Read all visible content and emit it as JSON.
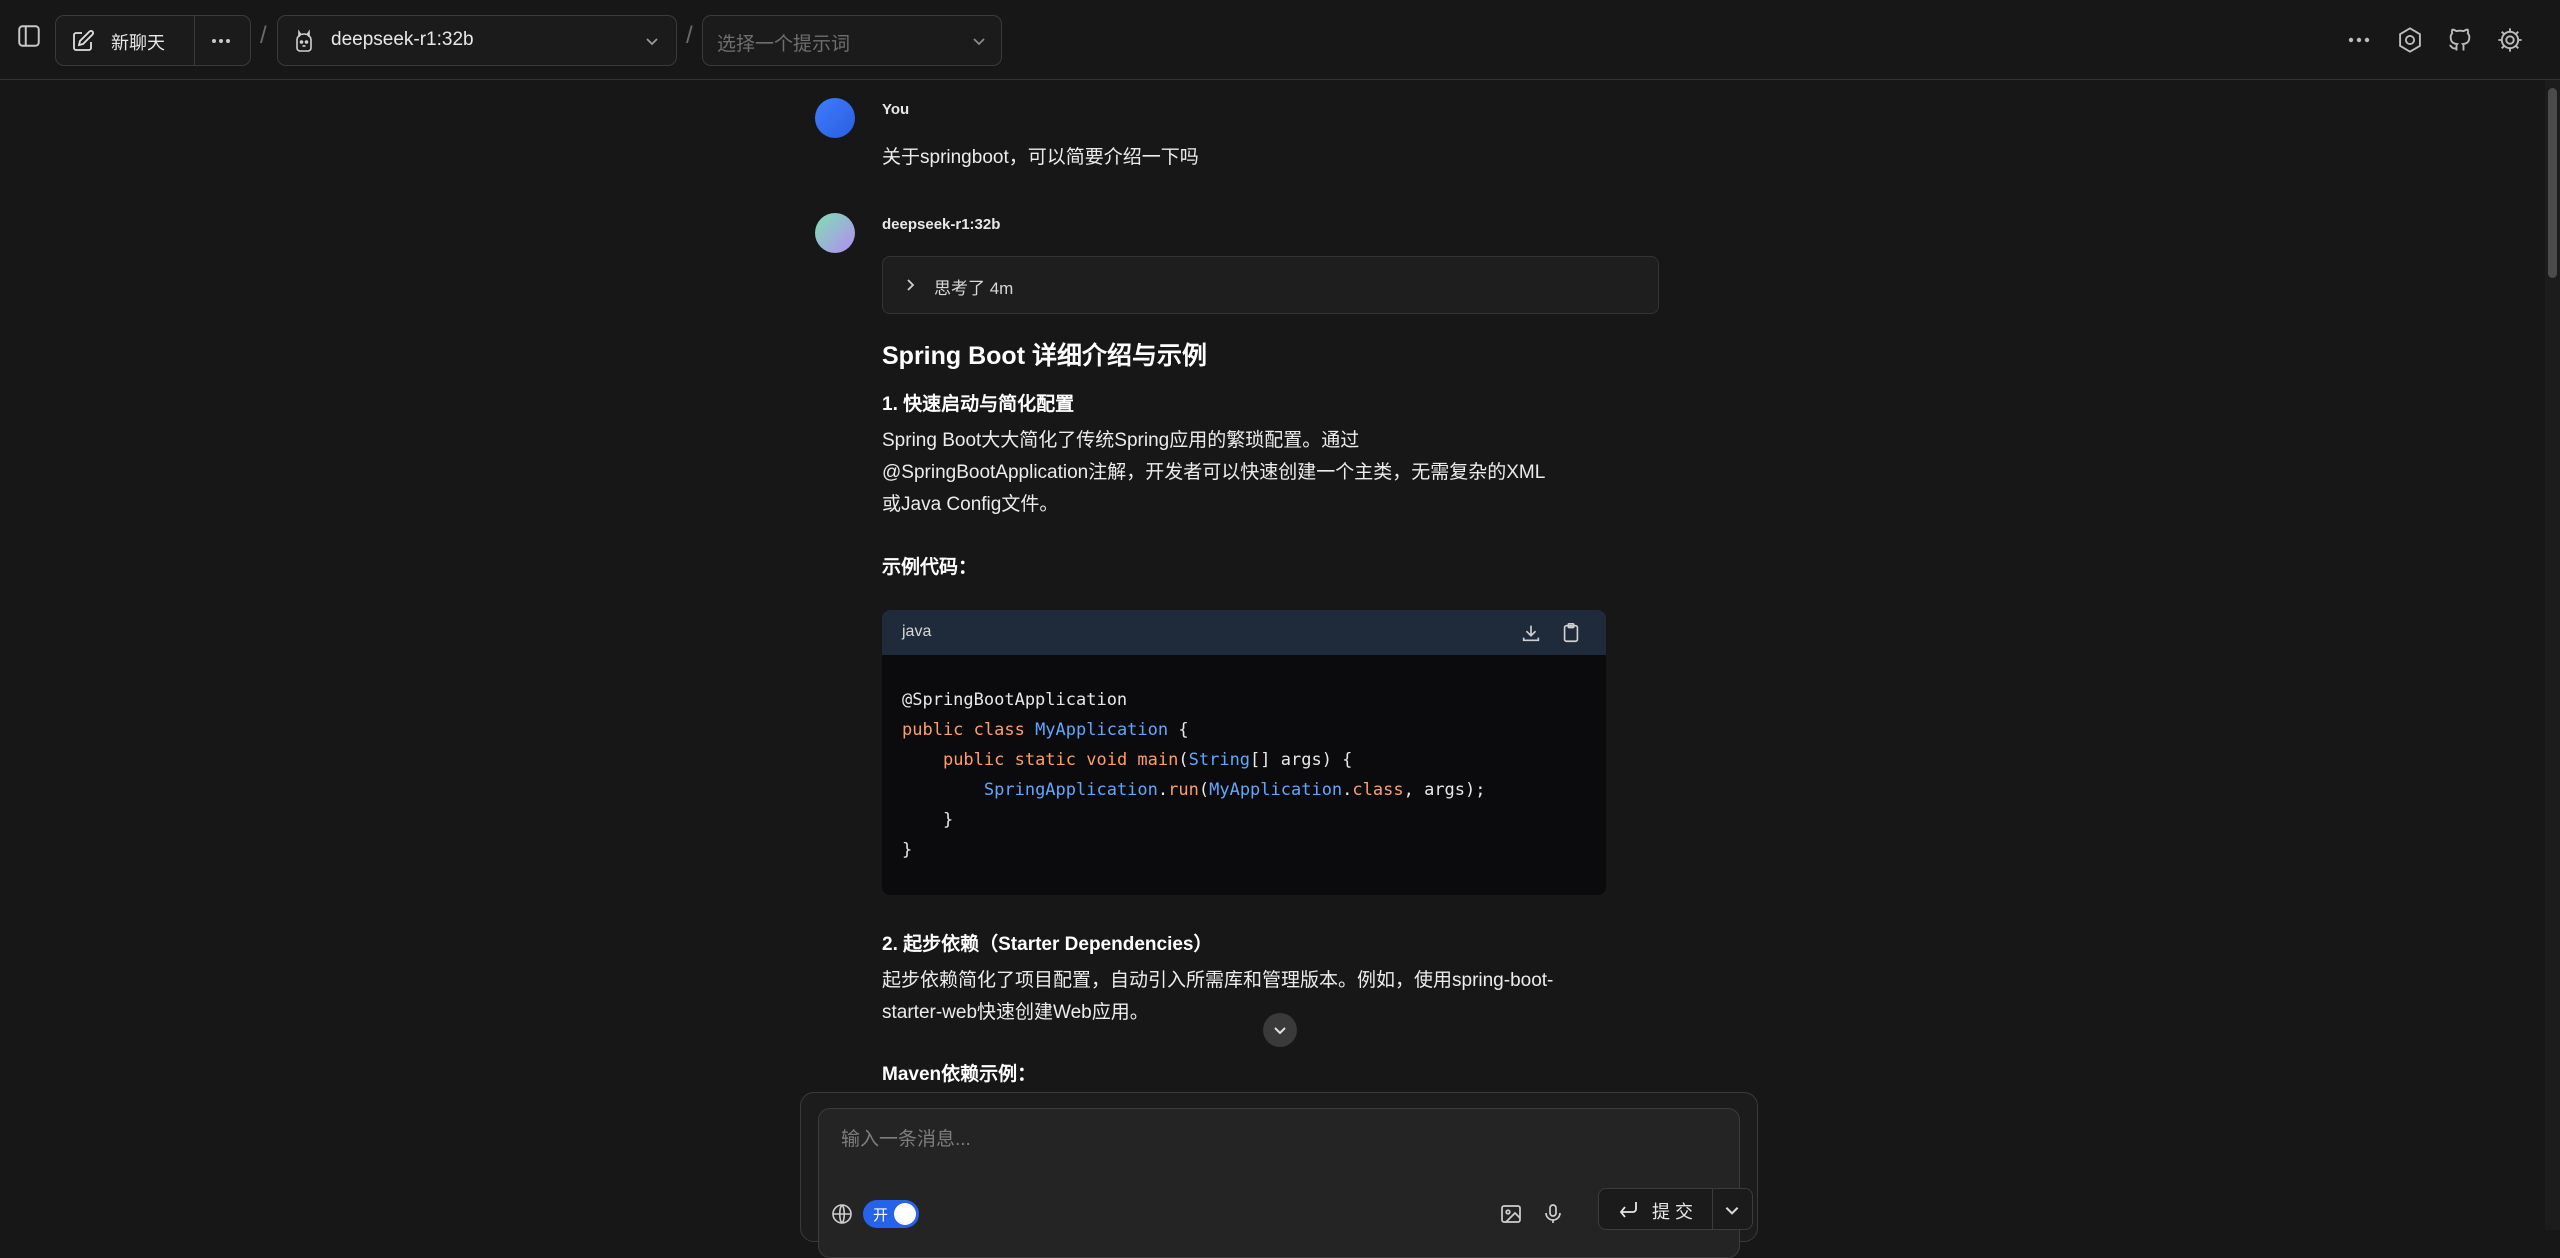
{
  "header": {
    "new_chat_label": "新聊天",
    "model_name": "deepseek-r1:32b",
    "prompt_placeholder": "选择一个提示词",
    "separator": "/"
  },
  "conversation": {
    "user": {
      "name": "You",
      "message": "关于springboot，可以简要介绍一下吗"
    },
    "assistant": {
      "name": "deepseek-r1:32b",
      "thinking_label": "思考了 4m",
      "title": "Spring Boot 详细介绍与示例",
      "section1_heading": "1. 快速启动与简化配置",
      "section1_text": [
        "Spring Boot大大简化了传统Spring应用的繁琐配置。通过",
        "@SpringBootApplication注解，开发者可以快速创建一个主类，无需复杂的XML",
        "或Java Config文件。"
      ],
      "example_label": "示例代码：",
      "code_language": "java",
      "code_lines": [
        "@SpringBootApplication",
        "public class MyApplication {",
        "    public static void main(String[] args) {",
        "        SpringApplication.run(MyApplication.class, args);",
        "    }",
        "}"
      ],
      "section2_heading": "2. 起步依赖（Starter Dependencies）",
      "section2_text": [
        "起步依赖简化了项目配置，自动引入所需库和管理版本。例如，使用spring-boot-",
        "starter-web快速创建Web应用。"
      ],
      "maven_label": "Maven依赖示例："
    }
  },
  "composer": {
    "placeholder": "输入一条消息...",
    "toggle_label": "开",
    "toggle_on": true,
    "submit_label": "提 交"
  },
  "colors": {
    "accent": "#2563eb",
    "background": "#171717",
    "code_header": "#1f2a3a"
  },
  "icons": [
    "sidebar-toggle-icon",
    "edit-icon",
    "more-icon",
    "model-logo-icon",
    "chevron-down-icon",
    "settings-icon",
    "github-icon",
    "gear-icon",
    "chevron-right-icon",
    "download-icon",
    "clipboard-icon",
    "globe-icon",
    "image-icon",
    "mic-icon",
    "enter-icon"
  ]
}
